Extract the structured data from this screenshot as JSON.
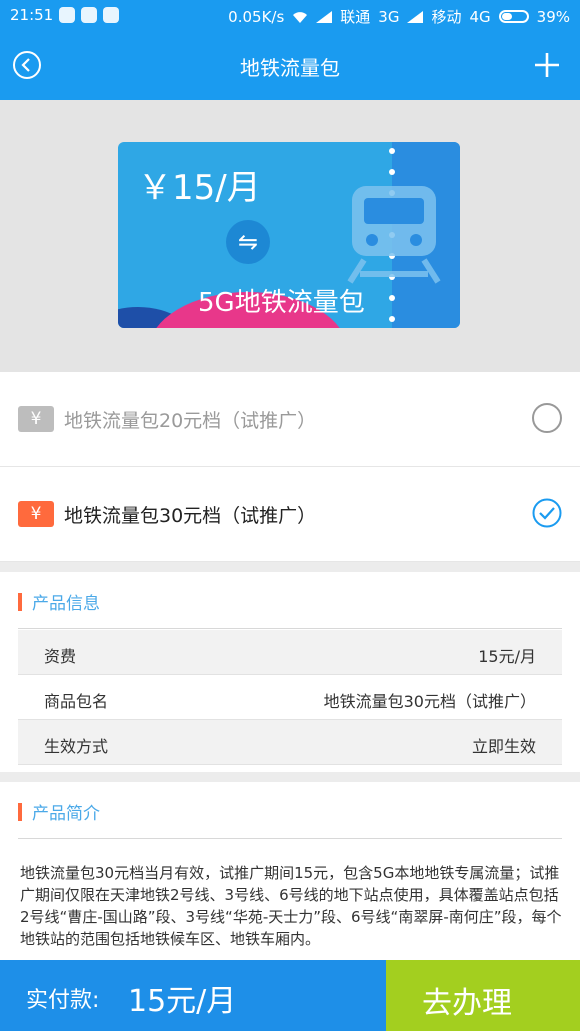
{
  "status_bar": {
    "time": "21:51",
    "net_speed": "0.05K/s",
    "carrier1": "联通",
    "net1": "3G",
    "carrier2": "移动",
    "net2": "4G",
    "battery": "39%"
  },
  "header": {
    "title": "地铁流量包"
  },
  "banner": {
    "price": "￥15/月",
    "name": "5G地铁流量包",
    "swap_glyph": "⇋"
  },
  "options": [
    {
      "label": "地铁流量包20元档（试推广）",
      "icon": "¥",
      "selected": false
    },
    {
      "label": "地铁流量包30元档（试推广）",
      "icon": "¥",
      "selected": true
    }
  ],
  "product_info": {
    "title": "产品信息",
    "rows": [
      {
        "key": "资费",
        "value": "15元/月"
      },
      {
        "key": "商品包名",
        "value": "地铁流量包30元档（试推广）"
      },
      {
        "key": "生效方式",
        "value": "立即生效"
      }
    ]
  },
  "product_intro": {
    "title": "产品简介",
    "text": "地铁流量包30元档当月有效，试推广期间15元，包含5G本地地铁专属流量；试推广期间仅限在天津地铁2号线、3号线、6号线的地下站点使用，具体覆盖站点包括2号线“曹庄-国山路”段、3号线“华苑-天士力”段、6号线“南翠屏-南何庄”段，每个地铁站的范围包括地铁候车区、地铁车厢内。"
  },
  "footer": {
    "pay_label": "实付款:",
    "pay_amount": "15元/月",
    "confirm_label": "去办理"
  },
  "colors": {
    "primary": "#1a9bf0",
    "accent": "#ff6a3d",
    "confirm": "#a3cf1f"
  }
}
